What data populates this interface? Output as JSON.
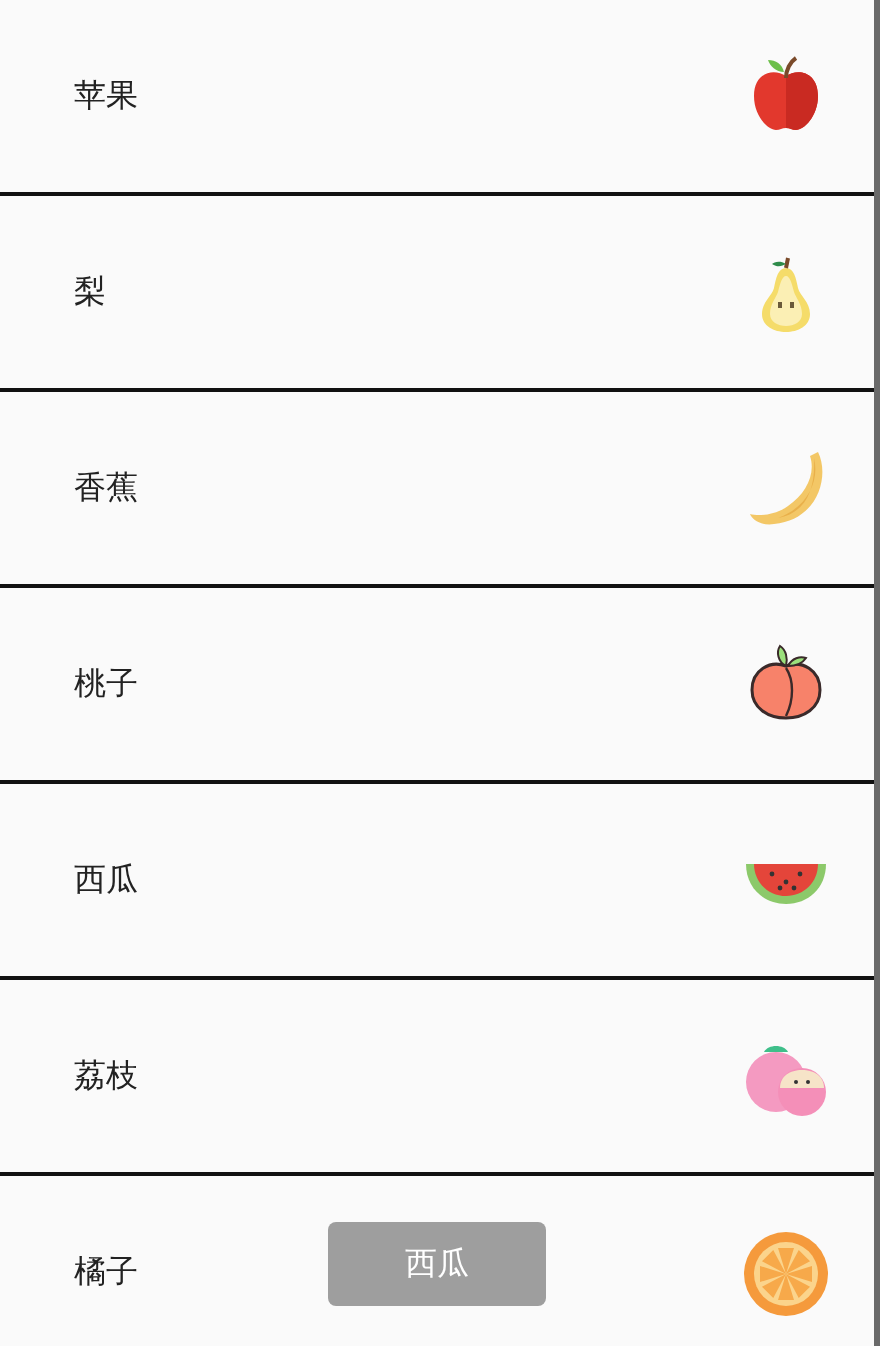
{
  "fruits": [
    {
      "label": "苹果",
      "kind": "apple"
    },
    {
      "label": "梨",
      "kind": "pear"
    },
    {
      "label": "香蕉",
      "kind": "banana"
    },
    {
      "label": "桃子",
      "kind": "peach"
    },
    {
      "label": "西瓜",
      "kind": "watermelon"
    },
    {
      "label": "荔枝",
      "kind": "lychee"
    },
    {
      "label": "橘子",
      "kind": "orange"
    }
  ],
  "toast": {
    "text": "西瓜"
  }
}
